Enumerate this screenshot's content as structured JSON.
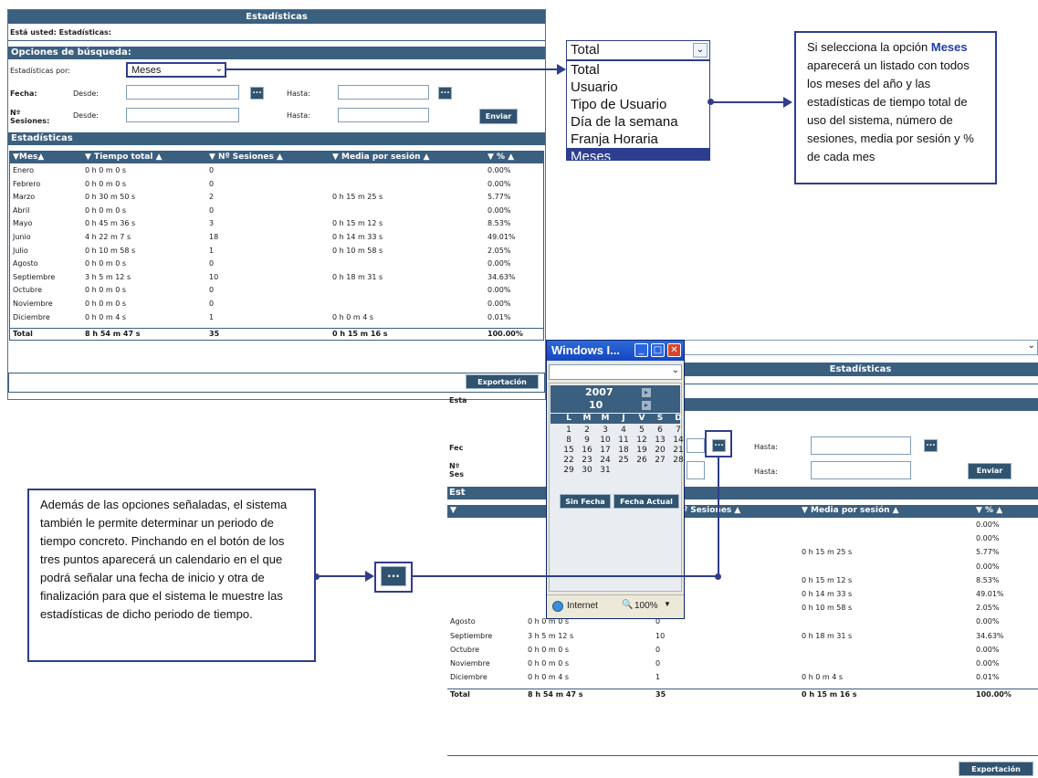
{
  "main": {
    "title": "Estadísticas",
    "breadcrumb": "Está usted: Estadísticas:",
    "options_header": "Opciones de búsqueda:",
    "stats_by_label": "Estadísticas por:",
    "stats_by_value": "Meses",
    "fecha_label": "Fecha:",
    "desde_label": "Desde:",
    "hasta_label": "Hasta:",
    "sesiones_label": "Nº Sesiones:",
    "enviar": "Enviar",
    "stats_header": "Estadísticas",
    "export": "Exportación",
    "columns": [
      "▼Mes▲",
      "▼ Tiempo total ▲",
      "▼ Nº Sesiones ▲",
      "▼ Media por sesión ▲",
      "▼ % ▲"
    ],
    "rows": [
      {
        "mes": "Enero",
        "tiempo": "0 h 0 m 0 s",
        "sesiones": "0",
        "media": "",
        "pct": "0.00%"
      },
      {
        "mes": "Febrero",
        "tiempo": "0 h 0 m 0 s",
        "sesiones": "0",
        "media": "",
        "pct": "0.00%"
      },
      {
        "mes": "Marzo",
        "tiempo": "0 h 30 m 50 s",
        "sesiones": "2",
        "media": "0 h 15 m 25 s",
        "pct": "5.77%"
      },
      {
        "mes": "Abril",
        "tiempo": "0 h 0 m 0 s",
        "sesiones": "0",
        "media": "",
        "pct": "0.00%"
      },
      {
        "mes": "Mayo",
        "tiempo": "0 h 45 m 36 s",
        "sesiones": "3",
        "media": "0 h 15 m 12 s",
        "pct": "8.53%"
      },
      {
        "mes": "Junio",
        "tiempo": "4 h 22 m 7 s",
        "sesiones": "18",
        "media": "0 h 14 m 33 s",
        "pct": "49.01%"
      },
      {
        "mes": "Julio",
        "tiempo": "0 h 10 m 58 s",
        "sesiones": "1",
        "media": "0 h 10 m 58 s",
        "pct": "2.05%"
      },
      {
        "mes": "Agosto",
        "tiempo": "0 h 0 m 0 s",
        "sesiones": "0",
        "media": "",
        "pct": "0.00%"
      },
      {
        "mes": "Septiembre",
        "tiempo": "3 h 5 m 12 s",
        "sesiones": "10",
        "media": "0 h 18 m 31 s",
        "pct": "34.63%"
      },
      {
        "mes": "Octubre",
        "tiempo": "0 h 0 m 0 s",
        "sesiones": "0",
        "media": "",
        "pct": "0.00%"
      },
      {
        "mes": "Noviembre",
        "tiempo": "0 h 0 m 0 s",
        "sesiones": "0",
        "media": "",
        "pct": "0.00%"
      },
      {
        "mes": "Diciembre",
        "tiempo": "0 h 0 m 4 s",
        "sesiones": "1",
        "media": "0 h 0 m 4 s",
        "pct": "0.01%"
      }
    ],
    "total": {
      "mes": "Total",
      "tiempo": "8 h 54 m 47 s",
      "sesiones": "35",
      "media": "0 h 15 m 16 s",
      "pct": "100.00%"
    }
  },
  "dropdown": {
    "selected": "Total",
    "options": [
      "Total",
      "Usuario",
      "Tipo de Usuario",
      "Día de la semana",
      "Franja Horaria",
      "Meses"
    ]
  },
  "note_top": {
    "before": "Si selecciona la opción",
    "highlight": "Meses",
    "after": "aparecerá un listado con todos los meses del año y las estadísticas de tiempo total de uso del sistema, número de sesiones, media por sesión y % de cada mes"
  },
  "note_bottom": {
    "text": "Además de las opciones señaladas, el sistema también le permite determinar un periodo de tiempo concreto. Pinchando en el botón de los tres puntos aparecerá un calendario en el que podrá señalar una fecha de inicio y otra de finalización para que el sistema le muestre las estadísticas de dicho periodo de tiempo."
  },
  "dots_label": "...",
  "calendar": {
    "window_title": "Windows I...",
    "year": "2007",
    "month": "10",
    "weekdays": [
      "L",
      "M",
      "M",
      "J",
      "V",
      "S",
      "D"
    ],
    "days": [
      [
        "1",
        "2",
        "3",
        "4",
        "5",
        "6",
        "7"
      ],
      [
        "8",
        "9",
        "10",
        "11",
        "12",
        "13",
        "14"
      ],
      [
        "15",
        "16",
        "17",
        "18",
        "19",
        "20",
        "21"
      ],
      [
        "22",
        "23",
        "24",
        "25",
        "26",
        "27",
        "28"
      ],
      [
        "29",
        "30",
        "31",
        "",
        "",
        "",
        ""
      ]
    ],
    "sin_fecha": "Sin Fecha",
    "fecha_actual": "Fecha Actual",
    "status_zone": "Internet",
    "status_zoom": "100%"
  },
  "overlap_labels": {
    "fecha_stub": "Fec",
    "sesiones_stub": "Nº Ses",
    "estadisticas_stub": "Est",
    "esta_stub": "Esta",
    "mes_stub": "▼"
  },
  "colors": {
    "header": "#3b5f7f",
    "accent": "#2f3e8a",
    "selected": "#2d3e90"
  }
}
